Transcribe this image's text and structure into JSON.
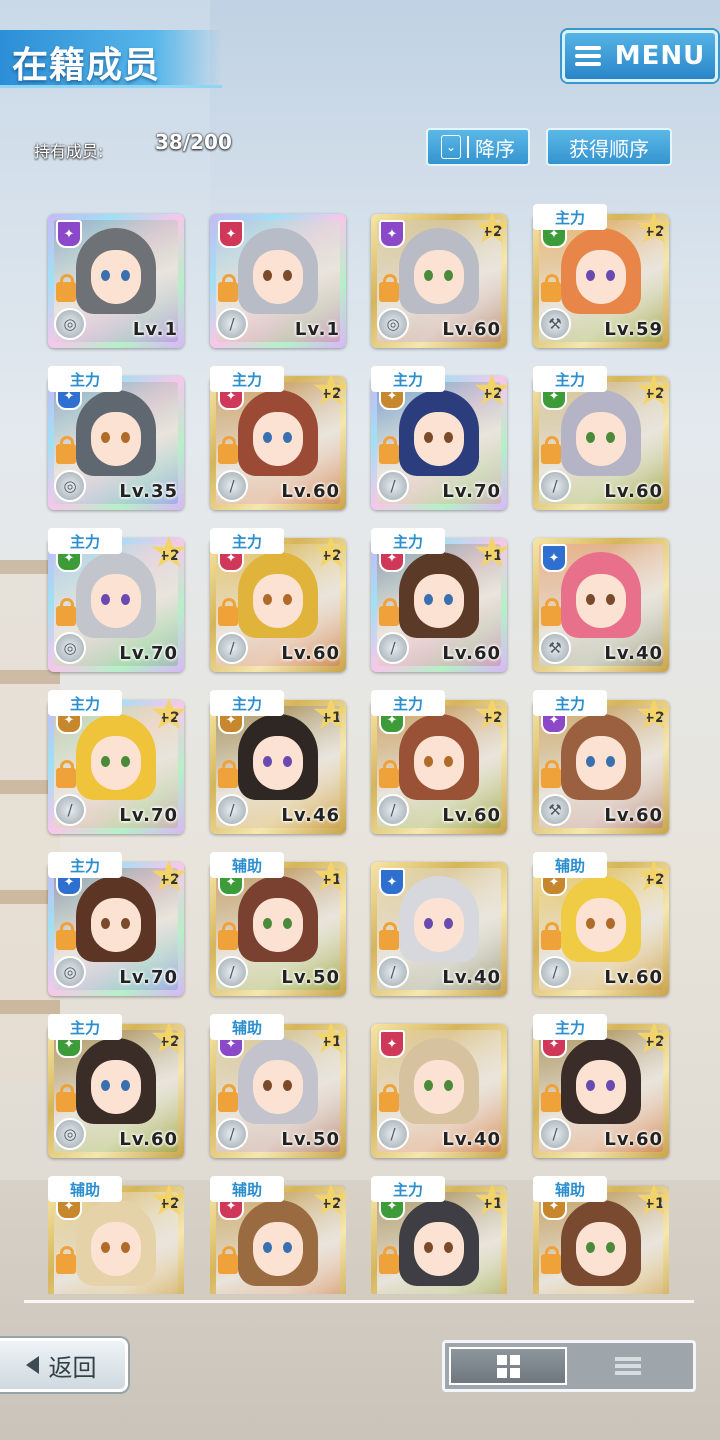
{
  "header": {
    "title": "在籍成员",
    "menu_label": "MENU"
  },
  "members": {
    "count_label": "持有成员:",
    "count_value": "38/200"
  },
  "sort": {
    "direction_label": "降序",
    "order_label": "获得顺序"
  },
  "cards": [
    {
      "role": "",
      "plus": "",
      "level": "Lv.1",
      "rainbow": true,
      "badge": "#8b48c9",
      "hair": "#6e7176",
      "weapon": "◎"
    },
    {
      "role": "",
      "plus": "",
      "level": "Lv.1",
      "rainbow": true,
      "badge": "#d0385a",
      "hair": "#b8bcc6",
      "weapon": "/"
    },
    {
      "role": "",
      "plus": "+2",
      "level": "Lv.60",
      "rainbow": false,
      "badge": "#8b48c9",
      "hair": "#b9bcc4",
      "weapon": "◎"
    },
    {
      "role": "主力",
      "plus": "+2",
      "level": "Lv.59",
      "rainbow": false,
      "badge": "#3d9b3a",
      "hair": "#e8864a",
      "weapon": "⚒"
    },
    {
      "role": "主力",
      "plus": "",
      "level": "Lv.35",
      "rainbow": true,
      "badge": "#2f6fd0",
      "hair": "#5f6770",
      "weapon": "◎"
    },
    {
      "role": "主力",
      "plus": "+2",
      "level": "Lv.60",
      "rainbow": false,
      "badge": "#d0385a",
      "hair": "#9a4a35",
      "weapon": "/"
    },
    {
      "role": "主力",
      "plus": "+2",
      "level": "Lv.70",
      "rainbow": true,
      "badge": "#c6872d",
      "hair": "#2b3d7c",
      "weapon": "/"
    },
    {
      "role": "主力",
      "plus": "+2",
      "level": "Lv.60",
      "rainbow": false,
      "badge": "#3d9b3a",
      "hair": "#b5b4c6",
      "weapon": "/"
    },
    {
      "role": "主力",
      "plus": "+2",
      "level": "Lv.70",
      "rainbow": true,
      "badge": "#3d9b3a",
      "hair": "#c2c5cc",
      "weapon": "◎"
    },
    {
      "role": "主力",
      "plus": "+2",
      "level": "Lv.60",
      "rainbow": false,
      "badge": "#d0385a",
      "hair": "#e0b43a",
      "weapon": "/"
    },
    {
      "role": "主力",
      "plus": "+1",
      "level": "Lv.60",
      "rainbow": true,
      "badge": "#d0385a",
      "hair": "#5c3a28",
      "weapon": "/"
    },
    {
      "role": "",
      "plus": "",
      "level": "Lv.40",
      "rainbow": false,
      "badge": "#2f6fd0",
      "hair": "#e8708a",
      "weapon": "⚒"
    },
    {
      "role": "主力",
      "plus": "+2",
      "level": "Lv.70",
      "rainbow": true,
      "badge": "#c6872d",
      "hair": "#f0c43a",
      "weapon": "/"
    },
    {
      "role": "主力",
      "plus": "+1",
      "level": "Lv.46",
      "rainbow": false,
      "badge": "#c6872d",
      "hair": "#2e2724",
      "weapon": "/"
    },
    {
      "role": "主力",
      "plus": "+2",
      "level": "Lv.60",
      "rainbow": false,
      "badge": "#3d9b3a",
      "hair": "#9a5236",
      "weapon": "/"
    },
    {
      "role": "主力",
      "plus": "+2",
      "level": "Lv.60",
      "rainbow": false,
      "badge": "#8b48c9",
      "hair": "#9a6040",
      "weapon": "⚒"
    },
    {
      "role": "主力",
      "plus": "+2",
      "level": "Lv.70",
      "rainbow": true,
      "badge": "#2f6fd0",
      "hair": "#5c3524",
      "weapon": "◎"
    },
    {
      "role": "辅助",
      "plus": "+1",
      "level": "Lv.50",
      "rainbow": false,
      "badge": "#3d9b3a",
      "hair": "#7a4030",
      "weapon": "/"
    },
    {
      "role": "",
      "plus": "",
      "level": "Lv.40",
      "rainbow": false,
      "badge": "#2f6fd0",
      "hair": "#d6d8de",
      "weapon": "/"
    },
    {
      "role": "辅助",
      "plus": "+2",
      "level": "Lv.60",
      "rainbow": false,
      "badge": "#c6872d",
      "hair": "#f0cb44",
      "weapon": "/"
    },
    {
      "role": "主力",
      "plus": "+2",
      "level": "Lv.60",
      "rainbow": false,
      "badge": "#3d9b3a",
      "hair": "#3a2c26",
      "weapon": "◎"
    },
    {
      "role": "辅助",
      "plus": "+1",
      "level": "Lv.50",
      "rainbow": false,
      "badge": "#8b48c9",
      "hair": "#c2c3cc",
      "weapon": "/"
    },
    {
      "role": "",
      "plus": "",
      "level": "Lv.40",
      "rainbow": false,
      "badge": "#d0385a",
      "hair": "#d7c2a0",
      "weapon": "/"
    },
    {
      "role": "主力",
      "plus": "+2",
      "level": "Lv.60",
      "rainbow": false,
      "badge": "#d0385a",
      "hair": "#3a2c28",
      "weapon": "/"
    },
    {
      "role": "辅助",
      "plus": "+2",
      "level": "",
      "rainbow": false,
      "badge": "#c6872d",
      "hair": "#e6d2a8",
      "weapon": ""
    },
    {
      "role": "辅助",
      "plus": "+2",
      "level": "",
      "rainbow": false,
      "badge": "#d0385a",
      "hair": "#9a6a40",
      "weapon": ""
    },
    {
      "role": "主力",
      "plus": "+1",
      "level": "",
      "rainbow": false,
      "badge": "#3d9b3a",
      "hair": "#3e3e44",
      "weapon": ""
    },
    {
      "role": "辅助",
      "plus": "+1",
      "level": "",
      "rainbow": false,
      "badge": "#c6872d",
      "hair": "#7a4a30",
      "weapon": ""
    }
  ],
  "footer": {
    "back_label": "返回"
  },
  "colors": {
    "accent": "#2a8ecf",
    "frame_gold": "#d6b55a",
    "lock": "#f0a23a"
  }
}
